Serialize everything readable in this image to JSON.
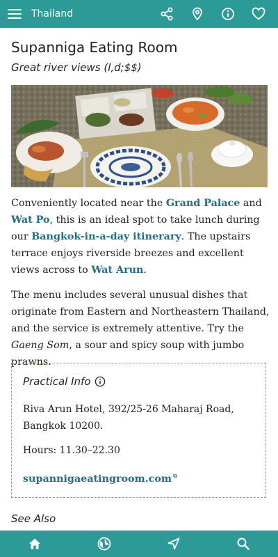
{
  "appbar": {
    "title": "Thailand",
    "icons": [
      "menu-icon",
      "share-icon",
      "map-pin-icon",
      "info-icon",
      "heart-icon"
    ]
  },
  "article": {
    "title": "Supanniga Eating Room",
    "subtitle": "Great river views (l,d;$$)",
    "photo_icon": "restaurant-photo",
    "p1": {
      "t1": "Conveniently located near the ",
      "l1": "Grand Palace",
      "t2": " and ",
      "l2": "Wat Po",
      "t3": ", this is an ideal spot to take lunch during our ",
      "l3": "Bangkok-in-a-day itinerary",
      "t4": ". The upstairs terrace enjoys riverside breezes and excellent views across to ",
      "l4": "Wat Arun",
      "t5": "."
    },
    "p2": {
      "t1": "The menu includes several unusual dishes that originate from Eastern and Northeastern Thailand, and the service is extremely attentive. Try the ",
      "em": "Gaeng Som",
      "t2": ", a sour and spicy soup with jumbo prawns."
    }
  },
  "practical": {
    "title": "Practical Info",
    "address": "Riva Arun Hotel, 392/25-26 Maharaj Road, Bangkok 10200.",
    "hours": "Hours: 11.30–22.30",
    "website": "supanniga­eatingroom.com"
  },
  "see_also": "See Also",
  "bottom_nav": [
    "home-icon",
    "globe-icon",
    "navigate-icon",
    "search-icon"
  ],
  "colors": {
    "bar": "#2c9a97",
    "link": "#1f6f8b",
    "box_border": "#6aa6c9"
  }
}
